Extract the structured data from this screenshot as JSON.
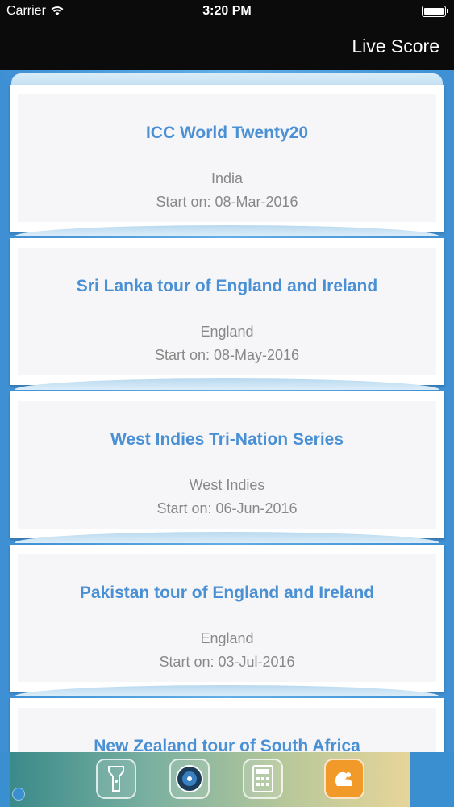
{
  "status_bar": {
    "carrier": "Carrier",
    "time": "3:20 PM"
  },
  "nav": {
    "title": "Live Score"
  },
  "series": [
    {
      "title": "ICC World Twenty20",
      "country": "India",
      "start": "Start on: 08-Mar-2016"
    },
    {
      "title": "Sri Lanka tour of England and Ireland",
      "country": "England",
      "start": "Start on: 08-May-2016"
    },
    {
      "title": "West Indies Tri-Nation Series",
      "country": "West Indies",
      "start": "Start on: 06-Jun-2016"
    },
    {
      "title": "Pakistan tour of England and Ireland",
      "country": "England",
      "start": "Start on: 03-Jul-2016"
    },
    {
      "title": "New Zealand tour of South Africa",
      "country": "",
      "start": ""
    }
  ],
  "ad": {
    "icons": [
      "flashlight-icon",
      "compass-icon",
      "calculator-icon",
      "squirrel-browser-icon"
    ]
  },
  "colors": {
    "title_blue": "#4a90d4",
    "background_blue": "#4a9bd9"
  }
}
